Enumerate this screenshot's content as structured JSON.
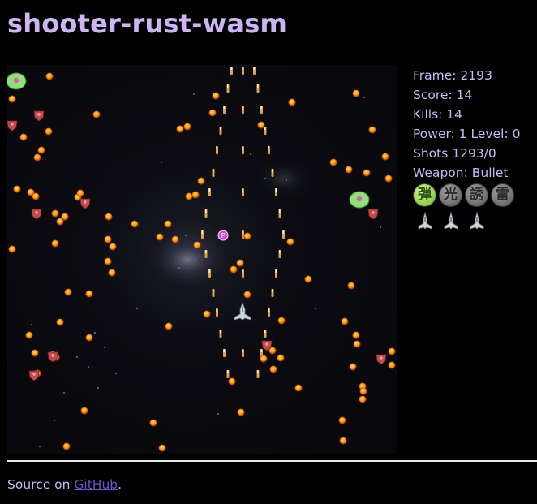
{
  "page": {
    "title": "shooter-rust-wasm"
  },
  "stats": {
    "frame": "Frame: 2193",
    "score": "Score: 14",
    "kills": "Kills: 14",
    "power": "Power: 1 Level: 0",
    "shots": "Shots 1293/0",
    "weapon": "Weapon: Bullet"
  },
  "weapons": {
    "items": [
      {
        "glyph": "弾",
        "active": true
      },
      {
        "glyph": "光",
        "active": false
      },
      {
        "glyph": "誘",
        "active": false
      },
      {
        "glyph": "雷",
        "active": false
      }
    ]
  },
  "lives": {
    "count": 3
  },
  "footer": {
    "prefix": "Source on ",
    "link_label": "GitHub",
    "suffix": "."
  },
  "colors": {
    "background": "#000000",
    "text": "#cbb6f2",
    "link": "#6f50c9",
    "enemy_bullet": "#ff9a10",
    "enemy": "#c44b4b",
    "boss": "#8fe07a",
    "player_shot": "#e0a24a",
    "weapon_active": "#8fcf4c",
    "weapon_inactive": "#7a7a7a"
  }
}
